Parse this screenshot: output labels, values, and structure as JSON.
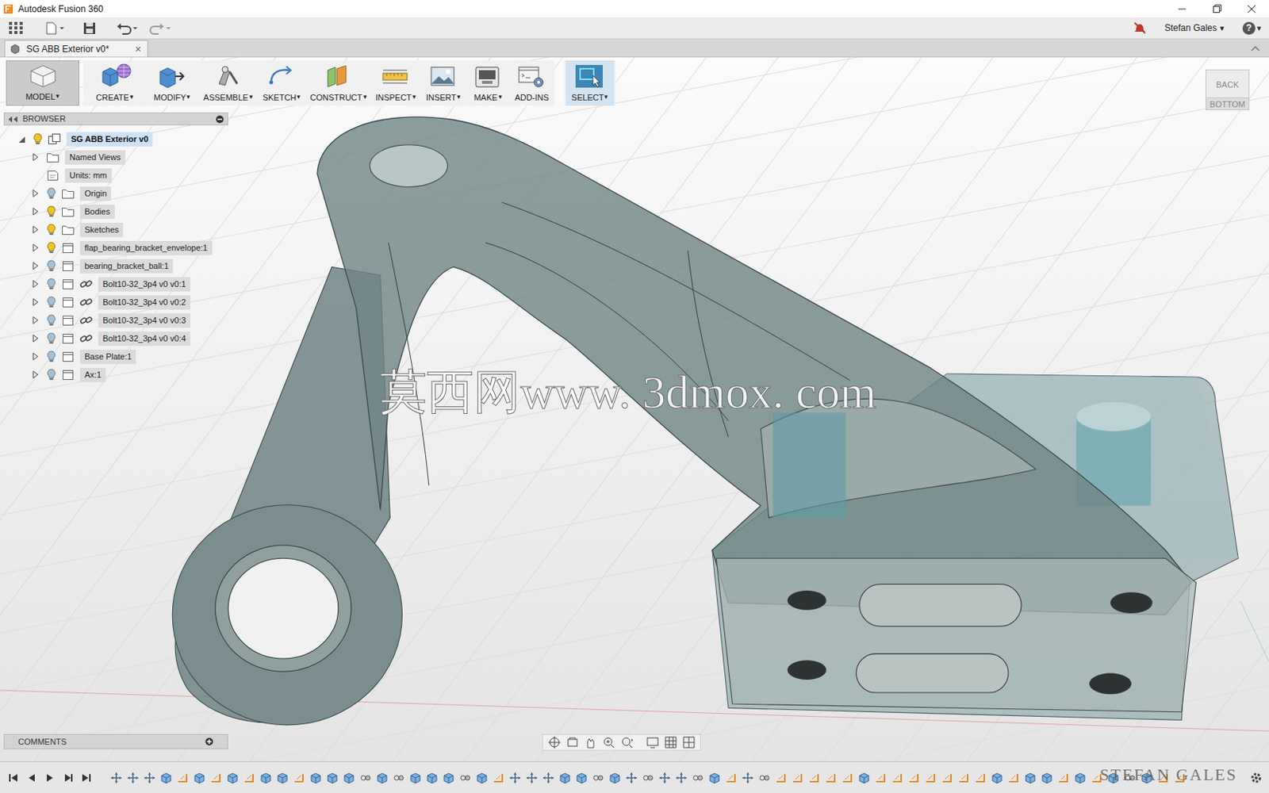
{
  "window": {
    "title": "Autodesk Fusion 360"
  },
  "user": {
    "name": "Stefan Gales",
    "arrow": "▾"
  },
  "help": {
    "label": "?",
    "arrow": "▾"
  },
  "document_tab": {
    "label": "SG ABB Exterior v0*",
    "close": "×",
    "selected": true
  },
  "ribbon": {
    "workspace": {
      "label": "MODEL",
      "arrow": "▾",
      "selected": true
    },
    "groups": [
      {
        "label": "CREATE",
        "arrow": "▾",
        "selected": false
      },
      {
        "label": "MODIFY",
        "arrow": "▾",
        "selected": false
      },
      {
        "label": "ASSEMBLE",
        "arrow": "▾",
        "selected": false
      },
      {
        "label": "SKETCH",
        "arrow": "▾",
        "selected": false
      },
      {
        "label": "CONSTRUCT",
        "arrow": "▾",
        "selected": false
      },
      {
        "label": "INSPECT",
        "arrow": "▾",
        "selected": false
      },
      {
        "label": "INSERT",
        "arrow": "▾",
        "selected": false
      },
      {
        "label": "MAKE",
        "arrow": "▾",
        "selected": false
      },
      {
        "label": "ADD-INS",
        "selected": false
      },
      {
        "label": "SELECT",
        "arrow": "▾",
        "selected": true
      }
    ]
  },
  "browser": {
    "title": "BROWSER",
    "items": [
      {
        "label": "SG ABB Exterior v0",
        "depth": 0,
        "kind": "root",
        "expandable": true,
        "expanded": true,
        "visible": true,
        "selected": true
      },
      {
        "label": "Named Views",
        "depth": 1,
        "kind": "folder",
        "expandable": true,
        "expanded": false,
        "selected": false
      },
      {
        "label": "Units: mm",
        "depth": 1,
        "kind": "units",
        "expandable": false,
        "expanded": false,
        "selected": false
      },
      {
        "label": "Origin",
        "depth": 1,
        "kind": "folder",
        "expandable": true,
        "expanded": false,
        "visible": false,
        "selected": false
      },
      {
        "label": "Bodies",
        "depth": 1,
        "kind": "folder",
        "expandable": true,
        "expanded": false,
        "visible": true,
        "selected": false
      },
      {
        "label": "Sketches",
        "depth": 1,
        "kind": "folder",
        "expandable": true,
        "expanded": false,
        "visible": true,
        "selected": false
      },
      {
        "label": "flap_bearing_bracket_envelope:1",
        "depth": 1,
        "kind": "component",
        "expandable": true,
        "expanded": false,
        "visible": true,
        "selected": false
      },
      {
        "label": "bearing_bracket_ball:1",
        "depth": 1,
        "kind": "component",
        "expandable": true,
        "expanded": false,
        "visible": false,
        "selected": false
      },
      {
        "label": "Bolt10-32_3p4 v0 v0:1",
        "depth": 1,
        "kind": "linked",
        "expandable": true,
        "expanded": false,
        "visible": false,
        "selected": false
      },
      {
        "label": "Bolt10-32_3p4 v0 v0:2",
        "depth": 1,
        "kind": "linked",
        "expandable": true,
        "expanded": false,
        "visible": false,
        "selected": false
      },
      {
        "label": "Bolt10-32_3p4 v0 v0:3",
        "depth": 1,
        "kind": "linked",
        "expandable": true,
        "expanded": false,
        "visible": false,
        "selected": false
      },
      {
        "label": "Bolt10-32_3p4 v0 v0:4",
        "depth": 1,
        "kind": "linked",
        "expandable": true,
        "expanded": false,
        "visible": false,
        "selected": false
      },
      {
        "label": "Base Plate:1",
        "depth": 1,
        "kind": "component",
        "expandable": true,
        "expanded": false,
        "visible": false,
        "selected": false
      },
      {
        "label": "Ax:1",
        "depth": 1,
        "kind": "component",
        "expandable": true,
        "expanded": false,
        "visible": false,
        "selected": false
      }
    ]
  },
  "comments": {
    "title": "COMMENTS"
  },
  "viewcube": {
    "faces": [
      "BACK",
      "BOTTOM"
    ]
  },
  "watermark": "莫西网www. 3dmox. com",
  "signature": "STEFAN GALES"
}
